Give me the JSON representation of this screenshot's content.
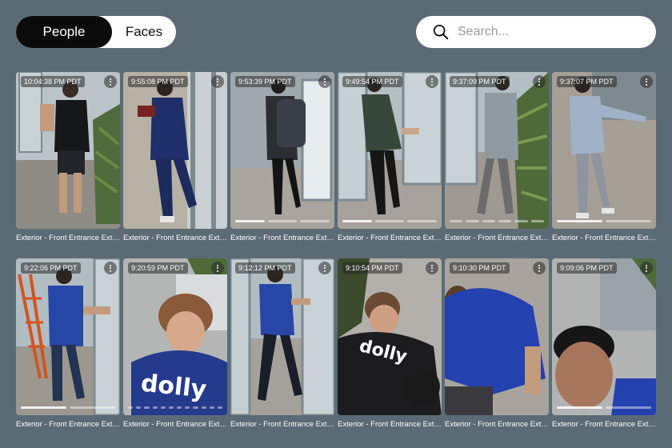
{
  "toggle": {
    "people": "People",
    "faces": "Faces"
  },
  "search": {
    "placeholder": "Search..."
  },
  "rows": [
    [
      {
        "time": "10:04:38 PM PDT",
        "label": "Exterior - Front Entrance Exteri..."
      },
      {
        "time": "9:55:08 PM PDT",
        "label": "Exterior - Front Entrance Exteri..."
      },
      {
        "time": "9:53:39 PM PDT",
        "label": "Exterior - Front Entrance Exteri..."
      },
      {
        "time": "9:49:54 PM PDT",
        "label": "Exterior - Front Entrance Exteri..."
      },
      {
        "time": "9:37:09 PM PDT",
        "label": "Exterior - Front Entrance Exteri..."
      },
      {
        "time": "9:37:07 PM PDT",
        "label": "Exterior - Front Entrance Exteri..."
      }
    ],
    [
      {
        "time": "9:22:06 PM PDT",
        "label": "Exterior - Front Entrance Exteri..."
      },
      {
        "time": "9:20:59 PM PDT",
        "label": "Exterior - Front Entrance Exteri..."
      },
      {
        "time": "9:12:12 PM PDT",
        "label": "Exterior - Front Entrance Exteri..."
      },
      {
        "time": "9:10:54 PM PDT",
        "label": "Exterior - Front Entrance Exteri..."
      },
      {
        "time": "9:10:30 PM PDT",
        "label": "Exterior - Front Entrance Exteri..."
      },
      {
        "time": "9:09:06 PM PDT",
        "label": "Exterior - Front Entrance Exteri..."
      }
    ]
  ],
  "shirt_texts": {
    "dolly": "dolly"
  },
  "icons": {
    "search": "search-icon",
    "menu": "more-vertical-icon"
  },
  "colors": {
    "background": "#5b6b76",
    "toggle_active": "#0b0b0b"
  }
}
